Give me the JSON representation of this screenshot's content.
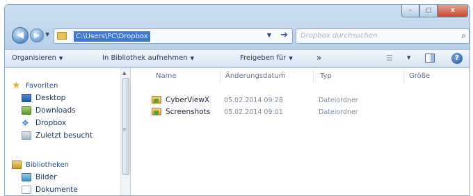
{
  "window": {
    "controls": {
      "minimize": "–",
      "maximize": "□",
      "close": "x"
    }
  },
  "address_bar": {
    "path": "C:\\Users\\PC\\Dropbox",
    "go_arrow": "➔",
    "dropdown_arrow": "▼"
  },
  "nav_buttons": {
    "back": "◀",
    "forward": "▶",
    "history": "▼"
  },
  "search": {
    "placeholder": "Dropbox durchsuchen",
    "icon": "⌕"
  },
  "toolbar": {
    "organize": "Organisieren",
    "include_library": "In Bibliothek aufnehmen",
    "share": "Freigeben für",
    "more": "»",
    "dropdown_arrow": "▼",
    "views_icon": "☰",
    "help": "?"
  },
  "nav_pane": {
    "favorites_header": "Favoriten",
    "favorites": [
      "Desktop",
      "Downloads",
      "Dropbox",
      "Zuletzt besucht"
    ],
    "libraries_header": "Bibliotheken",
    "libraries": [
      "Bilder",
      "Dokumente"
    ],
    "scroll_up": "▲",
    "scroll_grip": "≡"
  },
  "file_list": {
    "columns": [
      "Name",
      "Änderungsdatum",
      "Typ",
      "Größe"
    ],
    "sort_indicator": "︿",
    "rows": [
      {
        "name": "CyberViewX",
        "date": "05.02.2014 09:28",
        "type": "Dateiordner"
      },
      {
        "name": "Screenshots",
        "date": "05.02.2014 09:01",
        "type": "Dateiordner"
      }
    ]
  },
  "colors": {
    "address_highlight": "#3b79d3",
    "chrome_blue": "#b9d0ea"
  }
}
